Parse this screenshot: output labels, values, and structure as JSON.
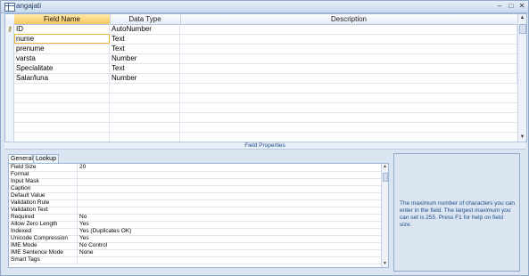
{
  "window": {
    "title": "angajati"
  },
  "grid": {
    "headers": [
      "Field Name",
      "Data Type",
      "Description"
    ],
    "rows": [
      {
        "name": "ID",
        "type": "AutoNumber",
        "primary_key": true
      },
      {
        "name": "nume",
        "type": "Text"
      },
      {
        "name": "prenume",
        "type": "Text"
      },
      {
        "name": "varsta",
        "type": "Number"
      },
      {
        "name": "Specialitate",
        "type": "Text"
      },
      {
        "name": "Salar/luna",
        "type": "Number"
      }
    ]
  },
  "field_properties": {
    "title": "Field Properties",
    "tabs": [
      "General",
      "Lookup"
    ],
    "props": [
      {
        "label": "Field Size",
        "value": "20"
      },
      {
        "label": "Format",
        "value": ""
      },
      {
        "label": "Input Mask",
        "value": ""
      },
      {
        "label": "Caption",
        "value": ""
      },
      {
        "label": "Default Value",
        "value": ""
      },
      {
        "label": "Validation Rule",
        "value": ""
      },
      {
        "label": "Validation Text",
        "value": ""
      },
      {
        "label": "Required",
        "value": "No"
      },
      {
        "label": "Allow Zero Length",
        "value": "Yes"
      },
      {
        "label": "Indexed",
        "value": "Yes (Duplicates OK)"
      },
      {
        "label": "Unicode Compression",
        "value": "Yes"
      },
      {
        "label": "IME Mode",
        "value": "No Control"
      },
      {
        "label": "IME Sentence Mode",
        "value": "None"
      },
      {
        "label": "Smart Tags",
        "value": ""
      }
    ],
    "help_text": "The maximum number of characters you can enter in the field. The largest maximum you can set is 255. Press F1 for help on field size."
  }
}
